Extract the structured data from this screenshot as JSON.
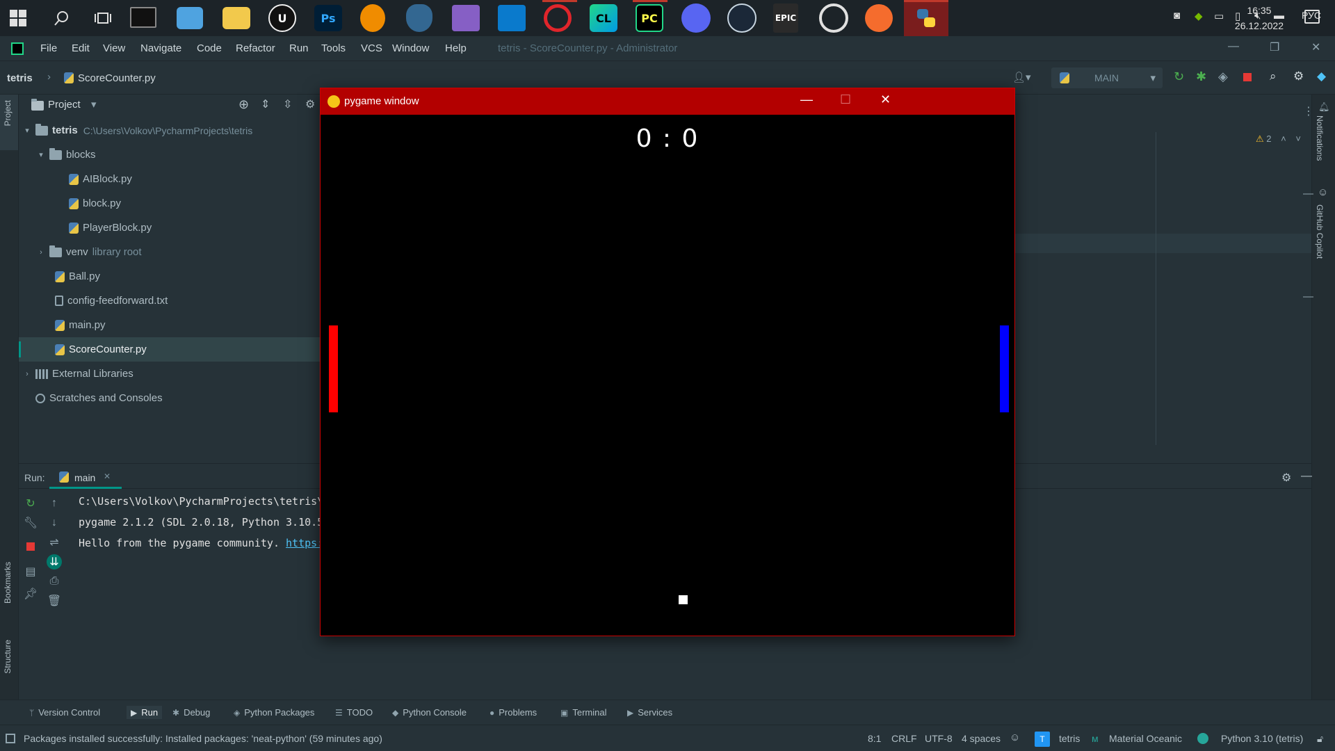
{
  "taskbar": {
    "apps": [
      {
        "name": "windows-start",
        "label": ""
      },
      {
        "name": "search",
        "label": ""
      },
      {
        "name": "task-view",
        "label": ""
      },
      {
        "name": "terminal",
        "label": ""
      },
      {
        "name": "control-panel",
        "label": ""
      },
      {
        "name": "file-explorer",
        "label": ""
      },
      {
        "name": "unreal-engine",
        "label": "U"
      },
      {
        "name": "photoshop",
        "label": "Ps"
      },
      {
        "name": "fl-studio",
        "label": ""
      },
      {
        "name": "pgadmin",
        "label": ""
      },
      {
        "name": "visual-studio",
        "label": ""
      },
      {
        "name": "vscode",
        "label": ""
      },
      {
        "name": "opera",
        "label": ""
      },
      {
        "name": "clion",
        "label": "CL"
      },
      {
        "name": "pycharm",
        "label": "PC"
      },
      {
        "name": "discord",
        "label": ""
      },
      {
        "name": "steam",
        "label": ""
      },
      {
        "name": "epic-games",
        "label": "EPIC"
      },
      {
        "name": "ubisoft-connect",
        "label": ""
      },
      {
        "name": "origin",
        "label": ""
      },
      {
        "name": "python",
        "label": ""
      }
    ],
    "language": "РУС",
    "time": "16:35",
    "date": "26.12.2022"
  },
  "menubar": {
    "items": [
      "File",
      "Edit",
      "View",
      "Navigate",
      "Code",
      "Refactor",
      "Run",
      "Tools",
      "VCS",
      "Window",
      "Help"
    ],
    "window_title": "tetris - ScoreCounter.py - Administrator"
  },
  "navbar": {
    "project": "tetris",
    "file": "ScoreCounter.py",
    "run_config": "MAIN"
  },
  "project_panel": {
    "title": "Project",
    "tree": {
      "root_name": "tetris",
      "root_path": "C:\\Users\\Volkov\\PycharmProjects\\tetris",
      "blocks": "blocks",
      "aiblock": "AIBlock.py",
      "block": "block.py",
      "playerblock": "PlayerBlock.py",
      "venv": "venv",
      "venv_note": "library root",
      "ball": "Ball.py",
      "config": "config-feedforward.txt",
      "main": "main.py",
      "scorecounter": "ScoreCounter.py",
      "external": "External Libraries",
      "scratches": "Scratches and Consoles"
    }
  },
  "editor": {
    "warnings": "2"
  },
  "left_strip": {
    "project_tab": "Project",
    "bookmarks_tab": "Bookmarks",
    "structure_tab": "Structure"
  },
  "right_strip": {
    "notifications_tab": "Notifications",
    "copilot_tab": "GitHub Copilot"
  },
  "run_panel": {
    "label": "Run:",
    "tab": "main",
    "lines": [
      "C:\\Users\\Volkov\\PycharmProjects\\tetris\\",
      "pygame 2.1.2 (SDL 2.0.18, Python 3.10.5",
      "Hello from the pygame community. "
    ],
    "link": "https:"
  },
  "bottom_tabs": [
    "Version Control",
    "Run",
    "Debug",
    "Python Packages",
    "TODO",
    "Python Console",
    "Problems",
    "Terminal",
    "Services"
  ],
  "statusbar": {
    "message": "Packages installed successfully: Installed packages: 'neat-python' (59 minutes ago)",
    "position": "8:1",
    "line_ending": "CRLF",
    "encoding": "UTF-8",
    "indent": "4 spaces",
    "project_badge": "T",
    "project": "tetris",
    "theme": "Material Oceanic",
    "interpreter": "Python 3.10 (tetris)"
  },
  "pygame": {
    "title": "pygame window",
    "score": "0 : 0",
    "left_paddle_color": "#ff0000",
    "right_paddle_color": "#0000ff",
    "ball_color": "#ffffff"
  }
}
